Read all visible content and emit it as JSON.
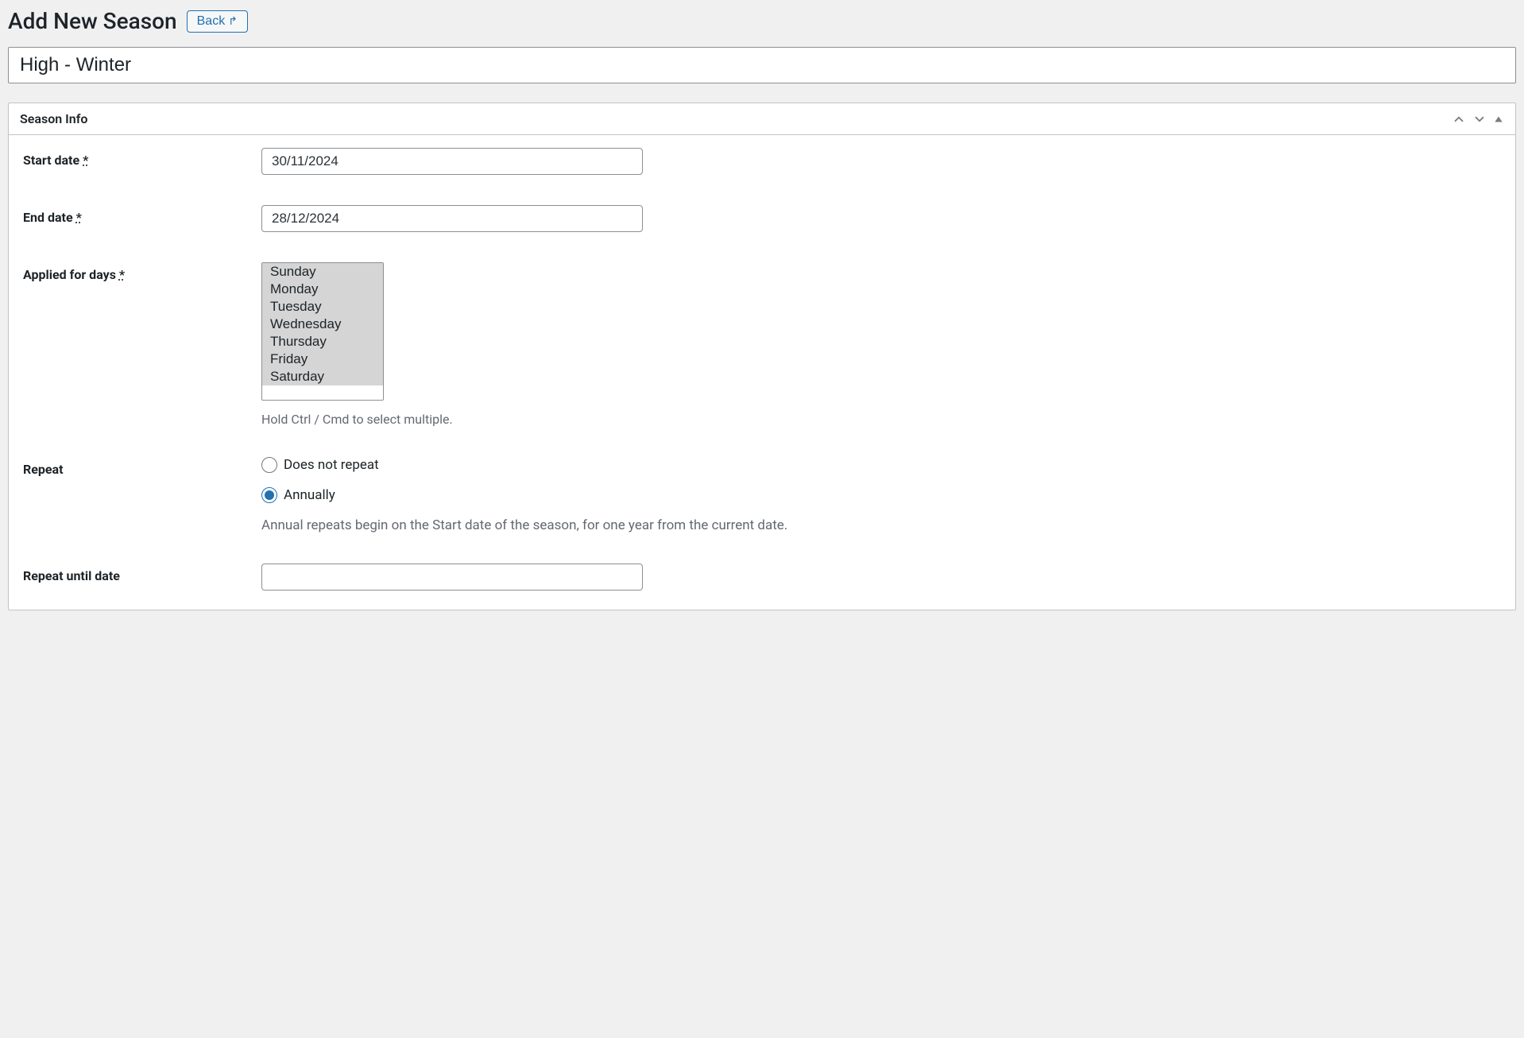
{
  "header": {
    "title": "Add New Season",
    "back_label": "Back"
  },
  "season": {
    "name": "High - Winter"
  },
  "metabox": {
    "title": "Season Info"
  },
  "form": {
    "start_date": {
      "label": "Start date",
      "required_mark": "*",
      "value": "30/11/2024"
    },
    "end_date": {
      "label": "End date",
      "required_mark": "*",
      "value": "28/12/2024"
    },
    "applied_days": {
      "label": "Applied for days",
      "required_mark": "*",
      "options": [
        "Sunday",
        "Monday",
        "Tuesday",
        "Wednesday",
        "Thursday",
        "Friday",
        "Saturday"
      ],
      "help": "Hold Ctrl / Cmd to select multiple."
    },
    "repeat": {
      "label": "Repeat",
      "options": {
        "none": "Does not repeat",
        "annually": "Annually"
      },
      "selected": "annually",
      "help": "Annual repeats begin on the Start date of the season, for one year from the current date."
    },
    "repeat_until": {
      "label": "Repeat until date",
      "value": ""
    }
  }
}
